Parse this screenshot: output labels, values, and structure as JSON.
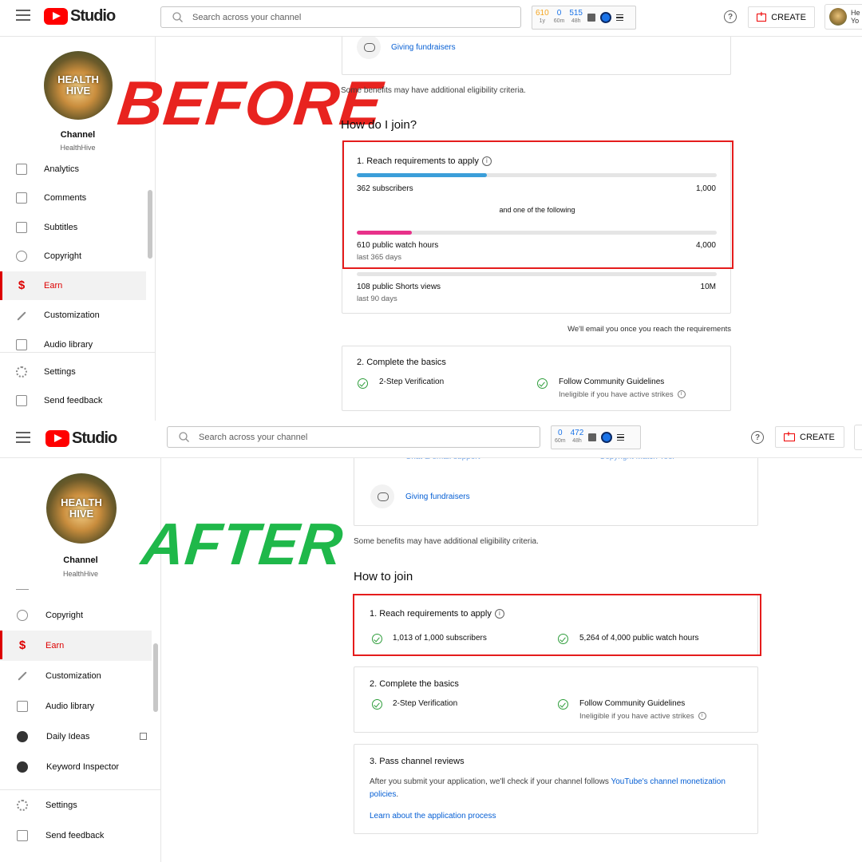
{
  "before": {
    "header": {
      "logo_text": "Studio",
      "search_placeholder": "Search across your channel",
      "stats": [
        {
          "value": "610",
          "label": "1y",
          "color": "#f5a623"
        },
        {
          "value": "0",
          "label": "60m",
          "color": "#1a73e8"
        },
        {
          "value": "515",
          "label": "48h",
          "color": "#1a73e8"
        }
      ],
      "help": "?",
      "create_label": "CREATE",
      "account_text": "He\nYo"
    },
    "sidebar": {
      "avatar_text": "HEALTH\nHIVE",
      "channel_label": "Channel",
      "channel_name": "HealthHive",
      "items": [
        "Analytics",
        "Comments",
        "Subtitles",
        "Copyright",
        "Earn",
        "Customization",
        "Audio library",
        "Settings",
        "Send feedback"
      ],
      "active": "Earn"
    },
    "overlay_label": "BEFORE",
    "overlay_color": "#e8231f",
    "main": {
      "fundraisers_link": "Giving fundraisers",
      "eligibility_note": "Some benefits may have additional eligibility criteria.",
      "join_heading": "How do I join?",
      "step1": {
        "title": "1. Reach requirements to apply",
        "info": "i",
        "subscribers": {
          "label": "362 subscribers",
          "target": "1,000",
          "progress": 0.362,
          "color": "#3b9ed9"
        },
        "and_one": "and one of the following",
        "watch_hours": {
          "label": "610 public watch hours",
          "sub": "last 365 days",
          "target": "4,000",
          "progress": 0.1525,
          "color": "#e8318a"
        },
        "shorts": {
          "label": "108 public Shorts views",
          "sub": "last 90 days",
          "target": "10M",
          "progress": 0.0
        }
      },
      "email_note": "We'll email you once you reach the requirements",
      "step2": {
        "title": "2. Complete the basics",
        "item1": "2-Step Verification",
        "item2": "Follow Community Guidelines",
        "item2_sub": "Ineligible if you have active strikes",
        "info": "i"
      }
    }
  },
  "after": {
    "header": {
      "logo_text": "Studio",
      "search_placeholder": "Search across your channel",
      "stats": [
        {
          "value": "0",
          "label": "60m",
          "color": "#1a73e8"
        },
        {
          "value": "472",
          "label": "48h",
          "color": "#1a73e8"
        }
      ],
      "help": "?",
      "create_label": "CREATE"
    },
    "sidebar": {
      "avatar_text": "HEALTH\nHIVE",
      "channel_label": "Channel",
      "channel_name": "HealthHive",
      "items": [
        "Copyright",
        "Earn",
        "Customization",
        "Audio library",
        "Daily Ideas",
        "Keyword Inspector",
        "Settings",
        "Send feedback"
      ],
      "active": "Earn"
    },
    "overlay_label": "AFTER",
    "overlay_color": "#1fb84a",
    "main": {
      "chat_support": "Chat & email support",
      "copyright_tool": "Copyright Match Tool",
      "fundraisers_link": "Giving fundraisers",
      "eligibility_note": "Some benefits may have additional eligibility criteria.",
      "join_heading": "How to join",
      "step1": {
        "title": "1. Reach requirements to apply",
        "info": "i",
        "req1": "1,013 of 1,000 subscribers",
        "req2": "5,264 of 4,000 public watch hours"
      },
      "step2": {
        "title": "2. Complete the basics",
        "item1": "2-Step Verification",
        "item2": "Follow Community Guidelines",
        "item2_sub": "Ineligible if you have active strikes",
        "info": "i"
      },
      "step3": {
        "title": "3. Pass channel reviews",
        "text_before": "After you submit your application, we'll check if your channel follows ",
        "text_link": "YouTube's channel monetization policies",
        "text_after": ".",
        "learn_link": "Learn about the application process"
      }
    }
  }
}
